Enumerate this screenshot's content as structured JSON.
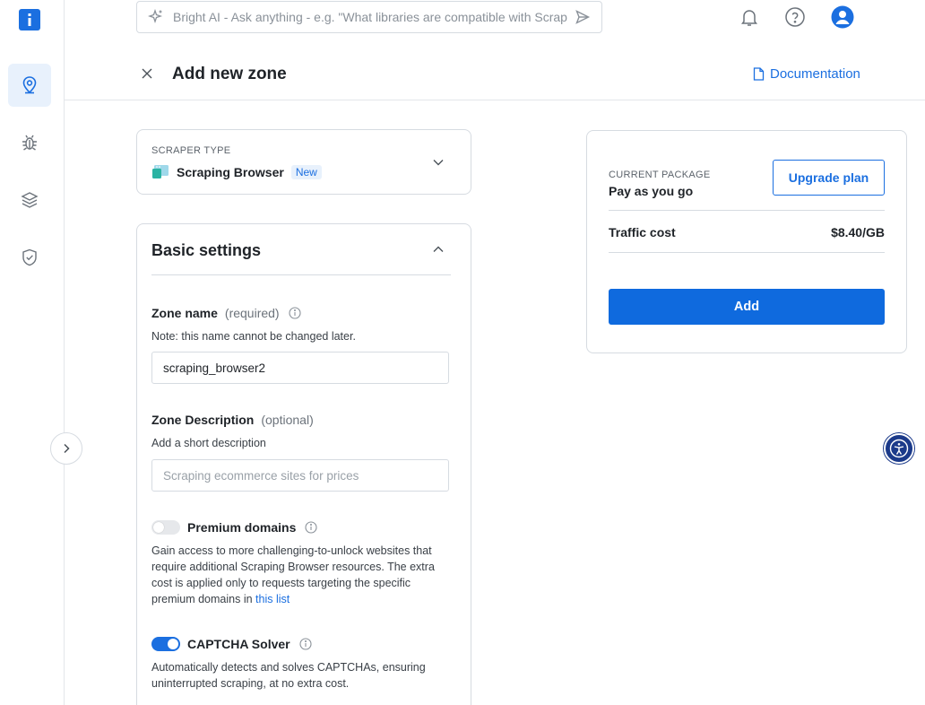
{
  "colors": {
    "accent": "#1b6fe0",
    "primary_button": "#0f6ade",
    "border": "#d6dbe1",
    "accessibility": "#1b3a8a"
  },
  "sidebar": {
    "logo_icon": "info-logo-icon",
    "items": [
      {
        "name": "location-pin-icon",
        "active": true
      },
      {
        "name": "bug-icon",
        "active": false
      },
      {
        "name": "layers-icon",
        "active": false
      },
      {
        "name": "shield-check-icon",
        "active": false
      }
    ],
    "collapse_icon": "chevron-right-icon"
  },
  "topbar": {
    "search_placeholder": "Bright AI - Ask anything - e.g. \"What libraries are compatible with Scrap",
    "icons": [
      "sparkle-icon",
      "send-icon",
      "bell-icon",
      "help-icon",
      "user-icon"
    ]
  },
  "header": {
    "title": "Add new zone",
    "documentation": "Documentation"
  },
  "scraper": {
    "label": "SCRAPER TYPE",
    "name": "Scraping Browser",
    "badge": "New"
  },
  "basic": {
    "title": "Basic settings",
    "zone_name": {
      "label": "Zone name",
      "hint": "(required)",
      "note": "Note: this name cannot be changed later.",
      "value": "scraping_browser2"
    },
    "zone_description": {
      "label": "Zone Description",
      "hint": "(optional)",
      "note": "Add a short description",
      "placeholder": "Scraping ecommerce sites for prices"
    },
    "premium_domains": {
      "label": "Premium domains",
      "enabled": false,
      "description": "Gain access to more challenging-to-unlock websites that require additional Scraping Browser resources. The extra cost is applied only to requests targeting the specific premium domains in",
      "link": "this list"
    },
    "captcha": {
      "label": "CAPTCHA Solver",
      "enabled": true,
      "description": "Automatically detects and solves CAPTCHAs, ensuring uninterrupted scraping, at no extra cost."
    }
  },
  "package": {
    "label": "CURRENT PACKAGE",
    "name": "Pay as you go",
    "upgrade": "Upgrade plan",
    "traffic_label": "Traffic cost",
    "traffic_value": "$8.40/GB",
    "add": "Add"
  }
}
